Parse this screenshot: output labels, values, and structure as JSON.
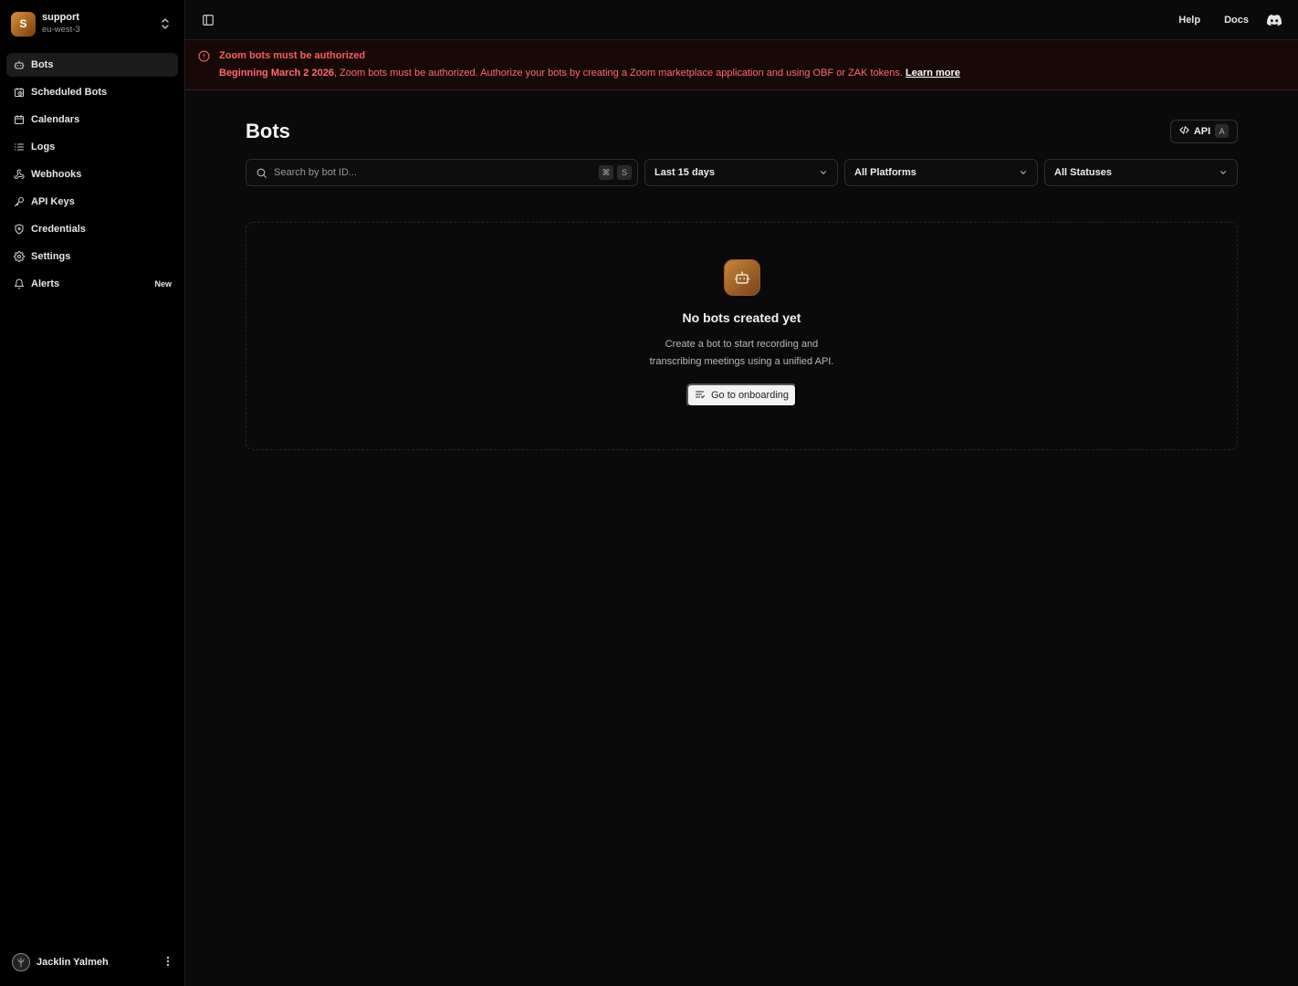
{
  "org": {
    "initial": "S",
    "name": "support",
    "region": "eu-west-3"
  },
  "sidebar": {
    "items": [
      {
        "label": "Bots",
        "icon": "bot-icon",
        "active": true
      },
      {
        "label": "Scheduled Bots",
        "icon": "scheduled-bot-icon"
      },
      {
        "label": "Calendars",
        "icon": "calendar-icon"
      },
      {
        "label": "Logs",
        "icon": "list-icon"
      },
      {
        "label": "Webhooks",
        "icon": "webhook-icon"
      },
      {
        "label": "API Keys",
        "icon": "key-icon"
      },
      {
        "label": "Credentials",
        "icon": "shield-icon"
      },
      {
        "label": "Settings",
        "icon": "gear-icon"
      },
      {
        "label": "Alerts",
        "icon": "bell-icon",
        "badge": "New"
      }
    ]
  },
  "user": {
    "name": "Jacklin Yalmeh"
  },
  "topbar": {
    "help": "Help",
    "docs": "Docs"
  },
  "alert": {
    "title": "Zoom bots must be authorized",
    "date": "Beginning March 2 2026",
    "message": ", Zoom bots must be authorized. Authorize your bots by creating a Zoom marketplace application and using OBF or ZAK tokens.",
    "link": "Learn more",
    "color": "#ff5c5c"
  },
  "page": {
    "title": "Bots",
    "api_label": "API",
    "api_shortcut": "A"
  },
  "filters": {
    "search_placeholder": "Search by bot ID...",
    "search_shortcut_mod": "⌘",
    "search_shortcut_key": "S",
    "date_range": "Last 15 days",
    "platform": "All Platforms",
    "status": "All Statuses"
  },
  "empty": {
    "title": "No bots created yet",
    "description": "Create a bot to start recording and transcribing meetings using a unified API.",
    "button": "Go to onboarding"
  }
}
